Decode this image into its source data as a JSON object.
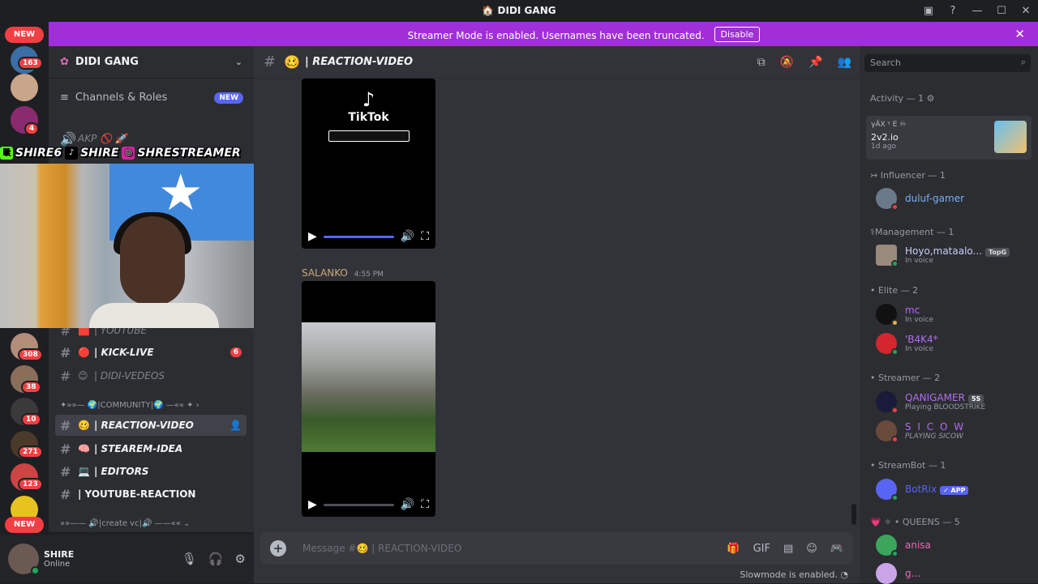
{
  "titlebar": {
    "title": "DIDI GANG"
  },
  "banner": {
    "message": "Streamer Mode is enabled. Usernames have been truncated.",
    "disable_label": "Disable"
  },
  "servers": {
    "new_top": "NEW",
    "new_bottom": "NEW",
    "badges": [
      "163",
      "4",
      "308",
      "38",
      "10",
      "271",
      "123",
      "163"
    ]
  },
  "channels": {
    "guild_name": "DIDI GANG",
    "roles_label": "Channels & Roles",
    "roles_badge": "NEW",
    "items": [
      {
        "name": "| YOUTUBE",
        "emoji": "🟥"
      },
      {
        "name": "| KICK-LIVE",
        "emoji": "🔴",
        "count": "6"
      },
      {
        "name": "| DIDI-VEDEOS",
        "emoji": "😊"
      },
      {
        "name": "| REACTION-VIDEO",
        "emoji": "🥴"
      },
      {
        "name": "| STEAREM-IDEA",
        "emoji": "🧠"
      },
      {
        "name": "| EDITORS",
        "emoji": "💻"
      },
      {
        "name": "| YOUTUBE-REACTION",
        "emoji": ""
      }
    ],
    "category_community": "✦»»— 🌍|COMMUNITY|🌍 —«« ✦ ›",
    "category_vc": "»»—— 🔊|create vc|🔊 ——«« ⌄",
    "voice_label": "AKP 🚫 🚀"
  },
  "overlay": {
    "kick": "SHIRE6",
    "tiktok": "SHIRE",
    "instagram": "SHRESTREAMER"
  },
  "user": {
    "name": "SHIRE",
    "status": "Online"
  },
  "main": {
    "channel_name": "| REACTION-VIDEO",
    "channel_emoji": "🥴",
    "tiktok_label": "TikTok",
    "author": "SALANKO",
    "time": "4:55 PM",
    "composer_placeholder": "Message #🥴 | REACTION-VIDEO",
    "slowmode": "Slowmode is enabled."
  },
  "members": {
    "search_placeholder": "Search",
    "activity_heading": "Activity — 1",
    "activity": {
      "line1": "γÂX ᵞ E ♾",
      "title": "2v2.io",
      "time": "1d ago"
    },
    "groups": [
      {
        "label": "↣ Influencer — 1",
        "members": [
          {
            "name": "duluf-gamer",
            "sub": ""
          }
        ]
      },
      {
        "label": "⚕Management — 1",
        "members": [
          {
            "name": "Hoyo,mataalo...",
            "sub": "In voice",
            "pill": "TopG"
          }
        ]
      },
      {
        "label": "• Elite — 2",
        "members": [
          {
            "name": "mc",
            "sub": "In voice"
          },
          {
            "name": "'B4K4*",
            "sub": "In voice"
          }
        ]
      },
      {
        "label": "• Streamer — 2",
        "members": [
          {
            "name": "QANIGAMER",
            "sub": "Playing BLOODSTRIKE",
            "pill": "5S"
          },
          {
            "name": "S I C O W",
            "sub": "PLAYING SICOW"
          }
        ]
      },
      {
        "label": "• StreamBot — 1",
        "members": [
          {
            "name": "BotRix",
            "sub": "",
            "pill": "✓ APP"
          }
        ]
      },
      {
        "label": "💗 ✧ • QUEENS — 5",
        "members": [
          {
            "name": "anisa",
            "sub": ""
          },
          {
            "name": "g...",
            "sub": ""
          }
        ]
      }
    ]
  },
  "colors": {
    "accent": "#5865f2",
    "banner": "#a12fd8",
    "online": "#23a55a",
    "danger": "#f23f43"
  }
}
